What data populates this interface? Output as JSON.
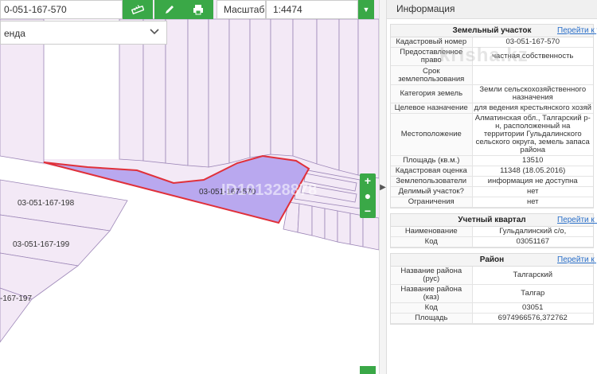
{
  "toolbar": {
    "search_value": "0-051-167-570",
    "scale_label": "Масштаб",
    "scale_value": "1:4474",
    "layer_value": "енда"
  },
  "map": {
    "plots": {
      "main": "03-051-167-570",
      "p198": "03-051-167-198",
      "p199": "03-051-167-199",
      "p197": "-167-197"
    },
    "zoom_in": "+",
    "zoom_out": "−",
    "watermark": "ID101328878"
  },
  "panel": {
    "title": "Информация",
    "watermark": "krisha.kz",
    "sections": {
      "land": {
        "heading": "Земельный участок",
        "goto": "Перейти к уч",
        "rows": [
          {
            "k": "Кадастровый номер",
            "v": "03-051-167-570"
          },
          {
            "k": "Предоставленное право",
            "v": "частная собственность"
          },
          {
            "k": "Срок землепользования",
            "v": ""
          },
          {
            "k": "Категория земель",
            "v": "Земли сельскохозяйственного назначения"
          },
          {
            "k": "Целевое назначение",
            "v": "для ведения крестьянского хозяй"
          },
          {
            "k": "Местоположение",
            "v": "Алматинская обл., Талгарский р-н, расположенный на территории Гульдалинского сельского округа, земель запаса района"
          },
          {
            "k": "Площадь (кв.м.)",
            "v": "13510"
          },
          {
            "k": "Кадастровая оценка",
            "v": "11348 (18.05.2016)"
          },
          {
            "k": "Землепользователи",
            "v": "информация не доступна"
          },
          {
            "k": "Делимый участок?",
            "v": "нет"
          },
          {
            "k": "Ограничения",
            "v": "нет"
          }
        ]
      },
      "quarter": {
        "heading": "Учетный квартал",
        "goto": "Перейти к кв",
        "rows": [
          {
            "k": "Наименование",
            "v": "Гульдалинский с/о,"
          },
          {
            "k": "Код",
            "v": "03051167"
          }
        ]
      },
      "district": {
        "heading": "Район",
        "goto": "Перейти к р",
        "rows": [
          {
            "k": "Название района (рус)",
            "v": "Талгарский"
          },
          {
            "k": "Название района (каз)",
            "v": "Талгар"
          },
          {
            "k": "Код",
            "v": "03051"
          },
          {
            "k": "Площадь",
            "v": "6974966576,372762"
          }
        ]
      }
    }
  },
  "colors": {
    "accent": "#3aa847",
    "parcel_fill": "#f3e9f6",
    "selected_fill": "#b9a8ef",
    "selected_stroke": "#e0303a",
    "link": "#2a6fc9"
  }
}
